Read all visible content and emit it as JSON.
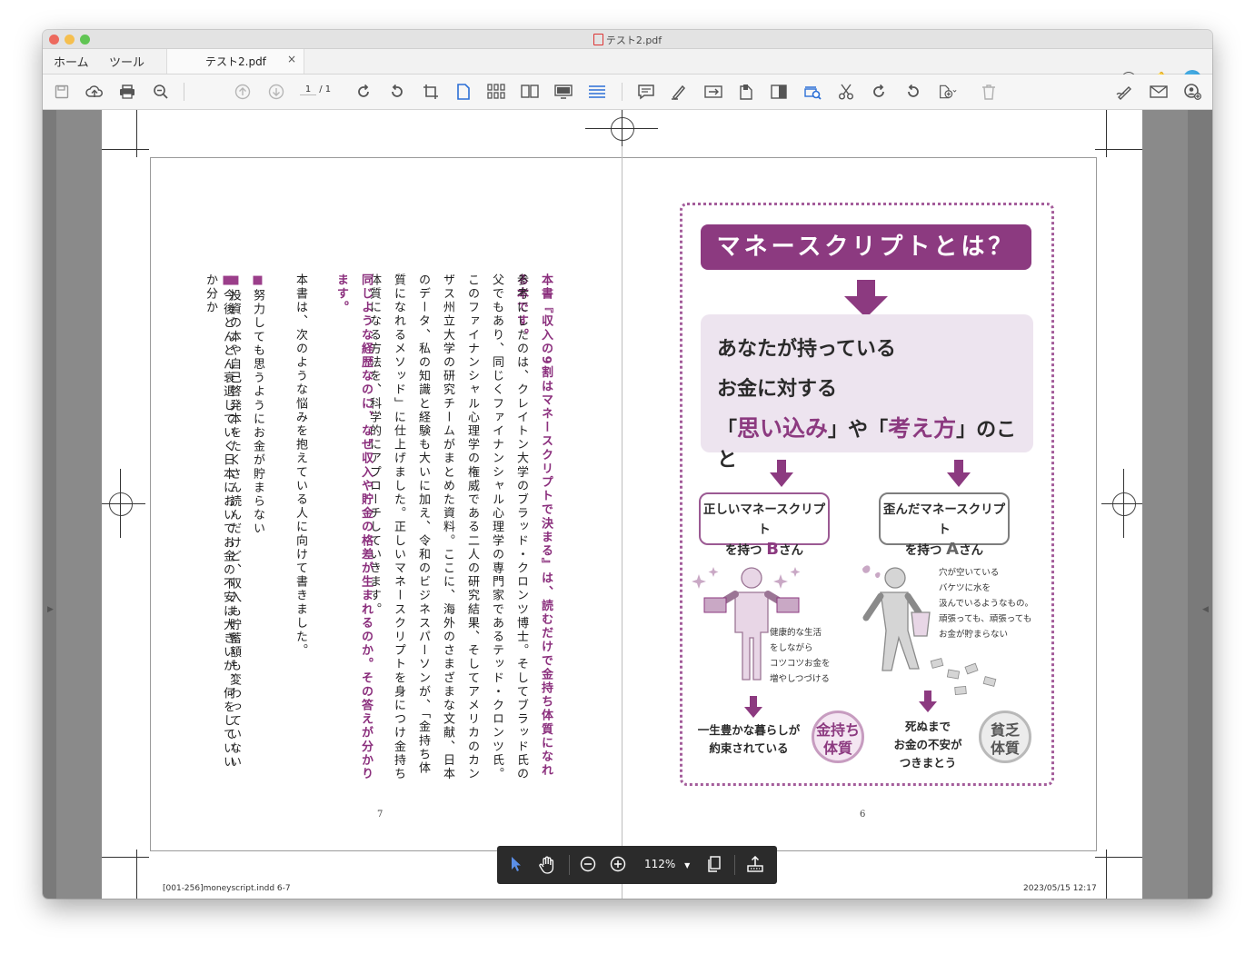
{
  "window": {
    "title": "テスト2.pdf"
  },
  "tabs": {
    "home": "ホーム",
    "tools": "ツール",
    "document": "テスト2.pdf",
    "close": "×"
  },
  "toolbar": {
    "page_current": "1",
    "page_total": "/  1"
  },
  "left_page": {
    "heading": "本書『収入の9割はマネースクリプトで決まる』は、読むだけで金持ち体質になれる本です。",
    "para1": "参考にしたのは、クレイトン大学のブラッド・クロンツ博士。そしてブラッド氏の父でもあり、同じくファイナンシャル心理学の専門家であるテッド・クロンツ氏。このファイナンシャル心理学の権威である二人の研究結果、そしてアメリカのカンザス州立大学の研究チームがまとめた資料。ここに、海外のさまざまな文献、日本のデータ、私の知識と経験も大いに加え、令和のビジネスパーソンが、「金持ち体質になれるメソッド」に仕上げました。正しいマネースクリプトを身につけ金持ち体質になる方法を、科学的にアプローチしていきます。",
    "purple2": "同じような経歴なのに、なぜ収入や貯金の格差が生まれるのか。その答えが分かります。",
    "para2": "本書は、次のような悩みを抱えている人に向けて書きました。",
    "bullets": [
      "努力しても思うようにお金が貯まらない",
      "投資の本や自己啓発本をたくさん読んだけど、収入も貯蓄額も変わっていない",
      "今後どんどん衰退していく日本においてお金の不安は大きいが、何をしていいか分か"
    ],
    "bullet_mark": "■",
    "page_number": "7"
  },
  "right_page": {
    "title": "マネースクリプトとは？",
    "line1": "あなたが持っている",
    "line2": "お金に対する",
    "q_open1": "「",
    "em1": "思い込み",
    "q_close1": "」",
    "ya": "や",
    "q_open2": "「",
    "em2": "考え方",
    "q_close2": "」",
    "koto": "のこと",
    "box_left_1": "正しいマネースクリプト",
    "box_left_pre": "を持つ ",
    "box_left_big": "B",
    "box_left_post": "さん",
    "box_right_1": "歪んだマネースクリプト",
    "box_right_pre": "を持つ ",
    "box_right_big": "A",
    "box_right_post": "さん",
    "left_note": [
      "健康的な生活",
      "をしながら",
      "コツコツお金を",
      "増やしつづける"
    ],
    "right_note": [
      "穴が空いている",
      "バケツに水を",
      "汲んでいるようなもの。",
      "頑張っても、頑張っても",
      "お金が貯まらない"
    ],
    "result_left": [
      "一生豊かな暮らしが",
      "約束されている"
    ],
    "result_right": [
      "死ぬまで",
      "お金の不安が",
      "つきまとう"
    ],
    "badge_rich_1": "金持ち",
    "badge_rich_2": "体質",
    "badge_poor_1": "貧乏",
    "badge_poor_2": "体質",
    "page_number": "6"
  },
  "slug": {
    "file": "[001-256]moneyscript.indd   6-7",
    "date": "2023/05/15   12:17"
  },
  "floating_toolbar": {
    "zoom": "112%"
  },
  "colors": {
    "accent_purple": "#8c3a80",
    "lilac": "#ede4ef",
    "toolbar_blue": "#2b6fd6"
  },
  "icons": [
    "save-icon",
    "upload-cloud-icon",
    "print-icon",
    "search-zoom-icon",
    "page-up-icon",
    "page-down-icon",
    "rotate-cw-icon",
    "rotate-ccw-icon",
    "crop-icon",
    "single-page-icon",
    "grid-view-icon",
    "two-page-icon",
    "presentation-icon",
    "scroll-icon",
    "comment-icon",
    "highlight-icon",
    "convert-icon",
    "export-icon",
    "redact-icon",
    "find-replace-icon",
    "scissors-icon",
    "redo-icon",
    "undo-icon",
    "insert-page-icon",
    "trash-icon",
    "sign-icon",
    "mail-icon",
    "add-user-icon"
  ]
}
